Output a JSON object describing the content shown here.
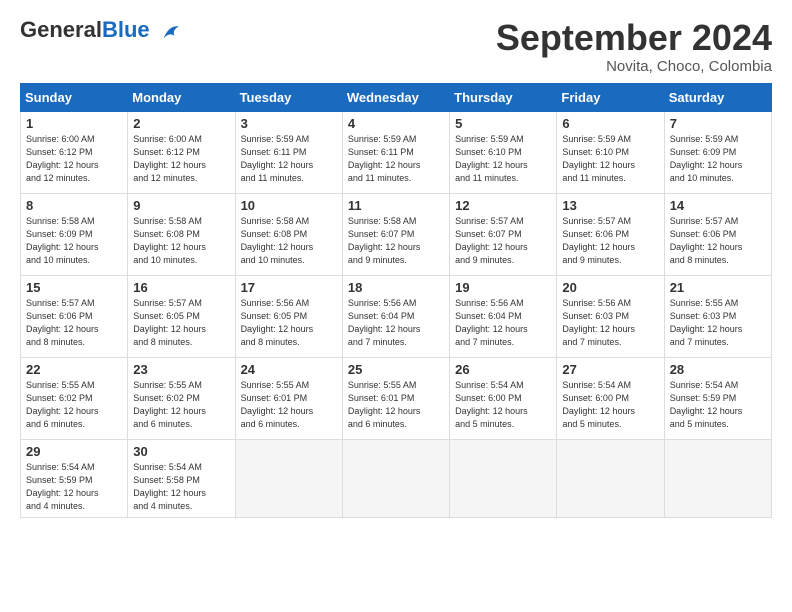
{
  "logo": {
    "general": "General",
    "blue": "Blue"
  },
  "header": {
    "month": "September 2024",
    "location": "Novita, Choco, Colombia"
  },
  "weekdays": [
    "Sunday",
    "Monday",
    "Tuesday",
    "Wednesday",
    "Thursday",
    "Friday",
    "Saturday"
  ],
  "weeks": [
    [
      {
        "day": "1",
        "info": "Sunrise: 6:00 AM\nSunset: 6:12 PM\nDaylight: 12 hours\nand 12 minutes."
      },
      {
        "day": "2",
        "info": "Sunrise: 6:00 AM\nSunset: 6:12 PM\nDaylight: 12 hours\nand 12 minutes."
      },
      {
        "day": "3",
        "info": "Sunrise: 5:59 AM\nSunset: 6:11 PM\nDaylight: 12 hours\nand 11 minutes."
      },
      {
        "day": "4",
        "info": "Sunrise: 5:59 AM\nSunset: 6:11 PM\nDaylight: 12 hours\nand 11 minutes."
      },
      {
        "day": "5",
        "info": "Sunrise: 5:59 AM\nSunset: 6:10 PM\nDaylight: 12 hours\nand 11 minutes."
      },
      {
        "day": "6",
        "info": "Sunrise: 5:59 AM\nSunset: 6:10 PM\nDaylight: 12 hours\nand 11 minutes."
      },
      {
        "day": "7",
        "info": "Sunrise: 5:59 AM\nSunset: 6:09 PM\nDaylight: 12 hours\nand 10 minutes."
      }
    ],
    [
      {
        "day": "8",
        "info": "Sunrise: 5:58 AM\nSunset: 6:09 PM\nDaylight: 12 hours\nand 10 minutes."
      },
      {
        "day": "9",
        "info": "Sunrise: 5:58 AM\nSunset: 6:08 PM\nDaylight: 12 hours\nand 10 minutes."
      },
      {
        "day": "10",
        "info": "Sunrise: 5:58 AM\nSunset: 6:08 PM\nDaylight: 12 hours\nand 10 minutes."
      },
      {
        "day": "11",
        "info": "Sunrise: 5:58 AM\nSunset: 6:07 PM\nDaylight: 12 hours\nand 9 minutes."
      },
      {
        "day": "12",
        "info": "Sunrise: 5:57 AM\nSunset: 6:07 PM\nDaylight: 12 hours\nand 9 minutes."
      },
      {
        "day": "13",
        "info": "Sunrise: 5:57 AM\nSunset: 6:06 PM\nDaylight: 12 hours\nand 9 minutes."
      },
      {
        "day": "14",
        "info": "Sunrise: 5:57 AM\nSunset: 6:06 PM\nDaylight: 12 hours\nand 8 minutes."
      }
    ],
    [
      {
        "day": "15",
        "info": "Sunrise: 5:57 AM\nSunset: 6:06 PM\nDaylight: 12 hours\nand 8 minutes."
      },
      {
        "day": "16",
        "info": "Sunrise: 5:57 AM\nSunset: 6:05 PM\nDaylight: 12 hours\nand 8 minutes."
      },
      {
        "day": "17",
        "info": "Sunrise: 5:56 AM\nSunset: 6:05 PM\nDaylight: 12 hours\nand 8 minutes."
      },
      {
        "day": "18",
        "info": "Sunrise: 5:56 AM\nSunset: 6:04 PM\nDaylight: 12 hours\nand 7 minutes."
      },
      {
        "day": "19",
        "info": "Sunrise: 5:56 AM\nSunset: 6:04 PM\nDaylight: 12 hours\nand 7 minutes."
      },
      {
        "day": "20",
        "info": "Sunrise: 5:56 AM\nSunset: 6:03 PM\nDaylight: 12 hours\nand 7 minutes."
      },
      {
        "day": "21",
        "info": "Sunrise: 5:55 AM\nSunset: 6:03 PM\nDaylight: 12 hours\nand 7 minutes."
      }
    ],
    [
      {
        "day": "22",
        "info": "Sunrise: 5:55 AM\nSunset: 6:02 PM\nDaylight: 12 hours\nand 6 minutes."
      },
      {
        "day": "23",
        "info": "Sunrise: 5:55 AM\nSunset: 6:02 PM\nDaylight: 12 hours\nand 6 minutes."
      },
      {
        "day": "24",
        "info": "Sunrise: 5:55 AM\nSunset: 6:01 PM\nDaylight: 12 hours\nand 6 minutes."
      },
      {
        "day": "25",
        "info": "Sunrise: 5:55 AM\nSunset: 6:01 PM\nDaylight: 12 hours\nand 6 minutes."
      },
      {
        "day": "26",
        "info": "Sunrise: 5:54 AM\nSunset: 6:00 PM\nDaylight: 12 hours\nand 5 minutes."
      },
      {
        "day": "27",
        "info": "Sunrise: 5:54 AM\nSunset: 6:00 PM\nDaylight: 12 hours\nand 5 minutes."
      },
      {
        "day": "28",
        "info": "Sunrise: 5:54 AM\nSunset: 5:59 PM\nDaylight: 12 hours\nand 5 minutes."
      }
    ],
    [
      {
        "day": "29",
        "info": "Sunrise: 5:54 AM\nSunset: 5:59 PM\nDaylight: 12 hours\nand 4 minutes."
      },
      {
        "day": "30",
        "info": "Sunrise: 5:54 AM\nSunset: 5:58 PM\nDaylight: 12 hours\nand 4 minutes."
      },
      {
        "day": "",
        "info": ""
      },
      {
        "day": "",
        "info": ""
      },
      {
        "day": "",
        "info": ""
      },
      {
        "day": "",
        "info": ""
      },
      {
        "day": "",
        "info": ""
      }
    ]
  ]
}
